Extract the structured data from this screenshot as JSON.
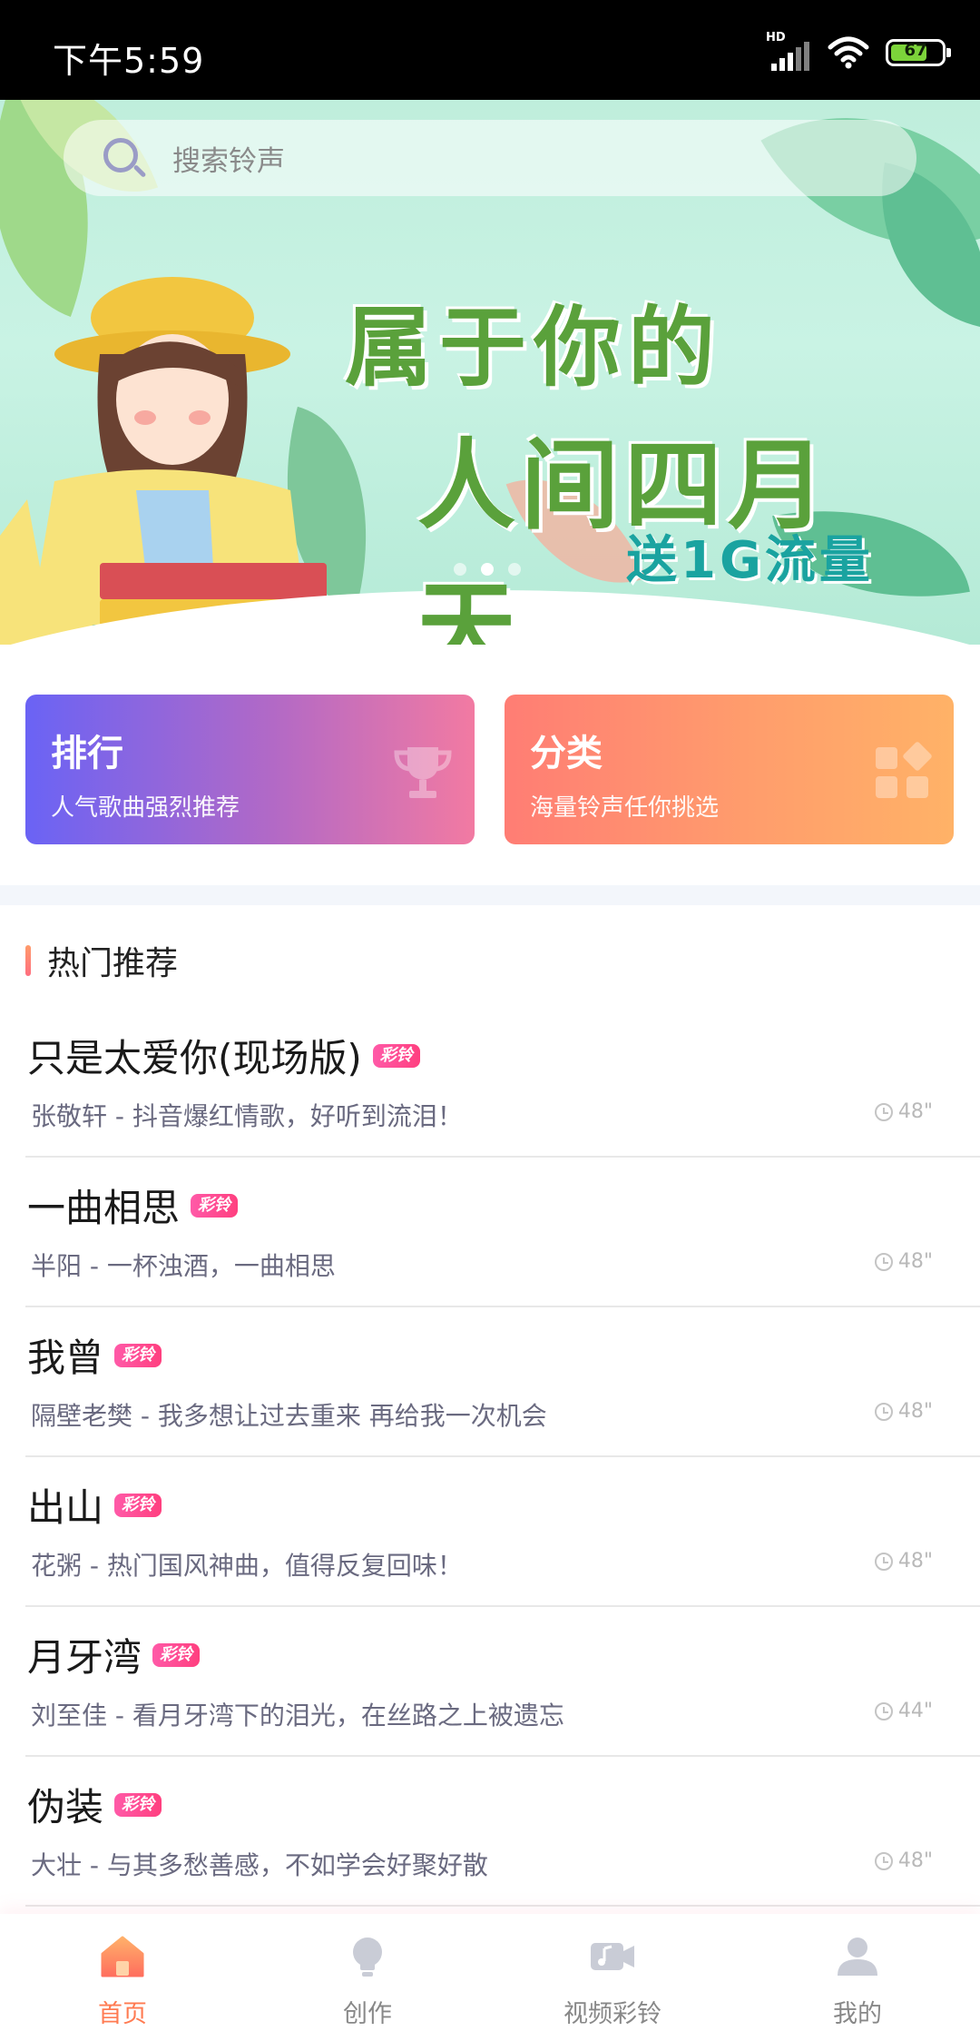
{
  "status_bar": {
    "time": "下午5:59",
    "network": "HD",
    "battery": "67"
  },
  "search": {
    "placeholder": "搜索铃声"
  },
  "banner": {
    "line1": "属于你的",
    "line2": "人间四月天",
    "line3": "送1G流量"
  },
  "cards": [
    {
      "title": "排行",
      "subtitle": "人气歌曲强烈推荐",
      "icon": "trophy-icon"
    },
    {
      "title": "分类",
      "subtitle": "海量铃声任你挑选",
      "icon": "category-icon"
    }
  ],
  "section": {
    "title": "热门推荐"
  },
  "tag_label": "彩铃",
  "songs": [
    {
      "title": "只是太爱你(现场版)",
      "subtitle": "张敬轩 - 抖音爆红情歌，好听到流泪！",
      "duration": "48\""
    },
    {
      "title": "一曲相思",
      "subtitle": "半阳 - 一杯浊酒，一曲相思",
      "duration": "48\""
    },
    {
      "title": "我曾",
      "subtitle": "隔壁老樊 - 我多想让过去重来 再给我一次机会",
      "duration": "48\""
    },
    {
      "title": "出山",
      "subtitle": "花粥 - 热门国风神曲，值得反复回味！",
      "duration": "48\""
    },
    {
      "title": "月牙湾",
      "subtitle": "刘至佳 - 看月牙湾下的泪光，在丝路之上被遗忘",
      "duration": "44\""
    },
    {
      "title": "伪装",
      "subtitle": "大壮 - 与其多愁善感，不如学会好聚好散",
      "duration": "48\""
    }
  ],
  "nav": [
    {
      "label": "首页",
      "icon": "home-icon",
      "active": true
    },
    {
      "label": "创作",
      "icon": "lightbulb-icon",
      "active": false
    },
    {
      "label": "视频彩铃",
      "icon": "video-icon",
      "active": false
    },
    {
      "label": "我的",
      "icon": "user-icon",
      "active": false
    }
  ],
  "colors": {
    "accent": "#ff7b52",
    "rank_start": "#6a63f5",
    "rank_end": "#f27aa2",
    "cate_start": "#ff7d74",
    "cate_end": "#ffb267",
    "tag": "#ff4f93"
  }
}
